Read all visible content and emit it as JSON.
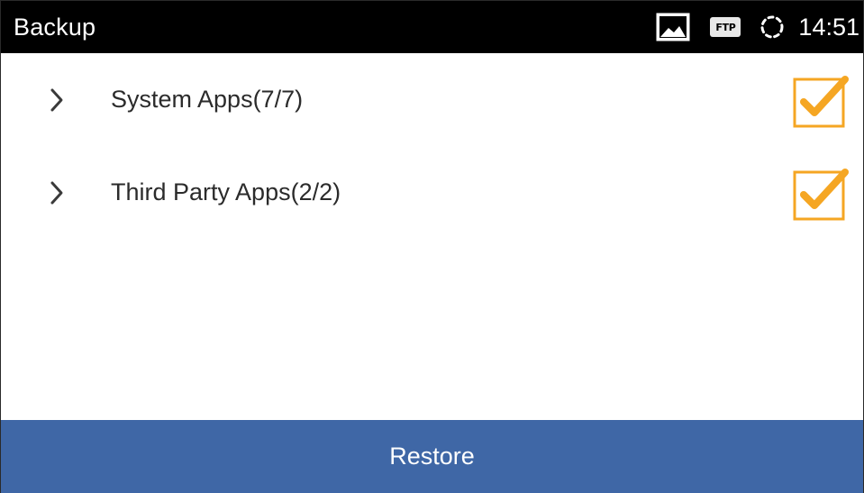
{
  "status_bar": {
    "title": "Backup",
    "ftp_label": "FTP",
    "time": "14:51",
    "icons": [
      "image-icon",
      "ftp-icon",
      "sync-icon"
    ]
  },
  "list": {
    "items": [
      {
        "label": "System Apps(7/7)",
        "checked": true
      },
      {
        "label": "Third Party Apps(2/2)",
        "checked": true
      }
    ]
  },
  "footer": {
    "restore_label": "Restore"
  },
  "colors": {
    "status_bar_bg": "#000000",
    "accent_check": "#f5a623",
    "button_bg": "#3f67a6"
  }
}
